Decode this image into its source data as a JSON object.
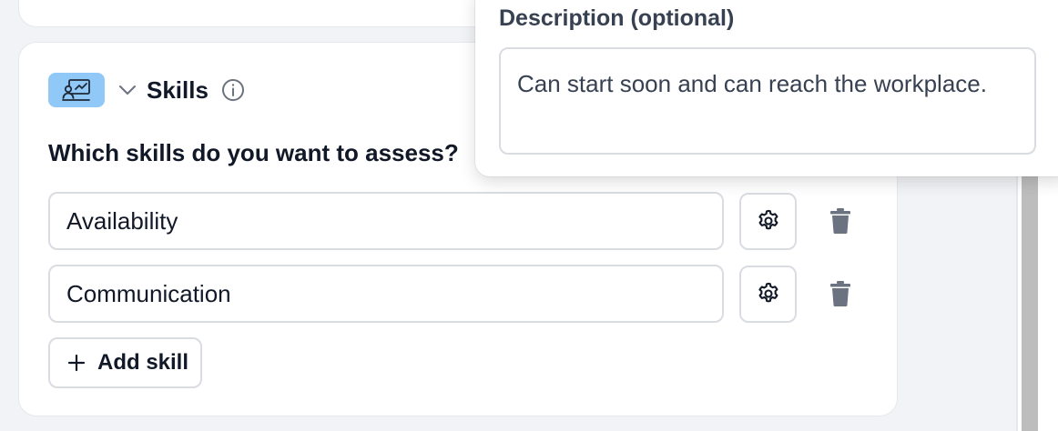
{
  "skills_section": {
    "title": "Skills",
    "question": "Which skills do you want to assess?",
    "items": [
      {
        "name": "Availability"
      },
      {
        "name": "Communication"
      }
    ],
    "add_label": "Add skill",
    "icons": {
      "badge": "skills-assessment-icon",
      "chevron": "chevron-down-icon",
      "info": "info-icon",
      "settings": "gear-icon",
      "delete": "trash-icon",
      "add": "plus-icon"
    },
    "colors": {
      "badge_bg": "#90c8f8",
      "icon_gray": "#6b7280"
    }
  },
  "description_popover": {
    "label": "Description (optional)",
    "value": "Can start soon and can reach the workplace."
  }
}
